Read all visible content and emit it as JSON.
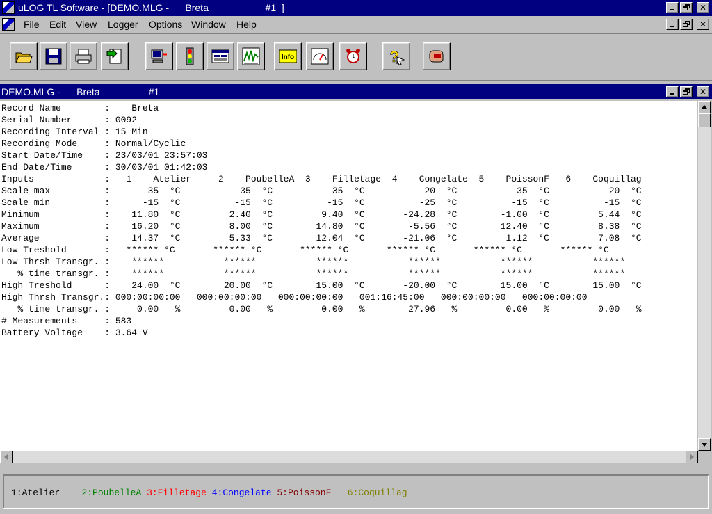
{
  "app": {
    "title": "uLOG TL Software - [DEMO.MLG -      Breta                     #1  ]"
  },
  "menu": {
    "items": [
      {
        "label": "File"
      },
      {
        "label": "Edit"
      },
      {
        "label": "View"
      },
      {
        "label": "Logger"
      },
      {
        "label": "Options"
      },
      {
        "label": "Window"
      },
      {
        "label": "Help"
      }
    ]
  },
  "toolbar": {
    "buttons": [
      {
        "icon": "open-folder-icon"
      },
      {
        "icon": "save-disk-icon"
      },
      {
        "icon": "printer-icon"
      },
      {
        "icon": "export-icon"
      },
      {
        "icon": "logger-connect-icon"
      },
      {
        "icon": "traffic-light-icon"
      },
      {
        "icon": "settings-panel-icon"
      },
      {
        "icon": "chart-icon"
      },
      {
        "icon": "info-icon",
        "label": "Info"
      },
      {
        "icon": "gauge-icon"
      },
      {
        "icon": "alarm-clock-icon"
      },
      {
        "icon": "help-icon"
      },
      {
        "icon": "exit-icon"
      }
    ]
  },
  "document": {
    "title": "DEMO.MLG -      Breta                  #1"
  },
  "report": {
    "lines": [
      "Record Name        :    Breta",
      "Serial Number      : 0092",
      "Recording Interval : 15 Min",
      "Recording Mode     : Normal/Cyclic",
      "Start Date/Time    : 23/03/01 23:57:03",
      "End Date/Time      : 30/03/01 01:42:03",
      "Inputs             :   1    Atelier     2    PoubelleA  3    Filletage  4    Congelate  5    PoissonF   6    Coquillag",
      "Scale max          :       35  °C           35  °C           35  °C           20  °C           35  °C           20  °C",
      "Scale min          :      -15  °C          -15  °C          -15  °C          -25  °C          -15  °C          -15  °C",
      "Minimum            :    11.80  °C         2.40  °C         9.40  °C       -24.28  °C        -1.00  °C         5.44  °C",
      "Maximum            :    16.20  °C         8.00  °C        14.80  °C        -5.56  °C        12.40  °C         8.38  °C",
      "Average            :    14.37  °C         5.33  °C        12.04  °C       -21.06  °C         1.12  °C         7.08  °C",
      "Low Treshold       :   ****** °C       ****** °C       ****** °C       ****** °C       ****** °C       ****** °C",
      "Low Thrsh Transgr. :    ******           ******           ******           ******           ******           ******",
      "   % time transgr. :    ******           ******           ******           ******           ******           ******",
      "High Treshold      :    24.00  °C        20.00  °C        15.00  °C       -20.00  °C        15.00  °C        15.00  °C",
      "High Thrsh Transgr.: 000:00:00:00   000:00:00:00   000:00:00:00   001:16:45:00   000:00:00:00   000:00:00:00",
      "   % time transgr. :     0.00   %         0.00   %         0.00   %        27.96   %         0.00   %         0.00   %",
      "# Measurements     : 583",
      "Battery Voltage    : 3.64 V"
    ]
  },
  "legend": {
    "channels": [
      {
        "label": "1:Atelier",
        "color": "#000000"
      },
      {
        "label": "2:PoubelleA",
        "color": "#008000"
      },
      {
        "label": "3:Filletage",
        "color": "#ff0000"
      },
      {
        "label": "4:Congelate",
        "color": "#0000ff"
      },
      {
        "label": "5:PoissonF",
        "color": "#800000"
      },
      {
        "label": "6:Coquillag",
        "color": "#808000"
      }
    ]
  }
}
